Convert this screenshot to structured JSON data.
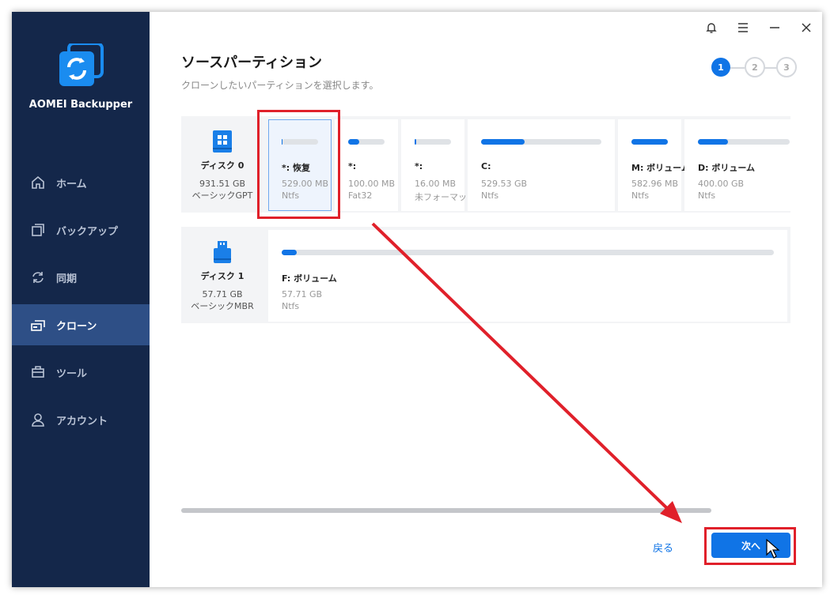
{
  "app": {
    "brand": "AOMEI Backupper"
  },
  "sidebar": {
    "items": [
      {
        "label": "ホーム",
        "icon": "home-icon"
      },
      {
        "label": "バックアップ",
        "icon": "backup-icon"
      },
      {
        "label": "同期",
        "icon": "sync-icon"
      },
      {
        "label": "クローン",
        "icon": "clone-icon",
        "active": true
      },
      {
        "label": "ツール",
        "icon": "tools-icon"
      },
      {
        "label": "アカウント",
        "icon": "account-icon"
      }
    ]
  },
  "header": {
    "title": "ソースパーティション",
    "subtitle": "クローンしたいパーティションを選択します。"
  },
  "steps": {
    "labels": [
      "1",
      "2",
      "3"
    ],
    "current": 1
  },
  "disks": [
    {
      "name": "ディスク 0",
      "size": "931.51 GB",
      "style": "ベーシックGPT",
      "partitions": [
        {
          "name": "*: 恢复",
          "size": "529.00 MB",
          "fs": "Ntfs",
          "used": 0.02,
          "selected": true
        },
        {
          "name": "*:",
          "size": "100.00 MB",
          "fs": "Fat32",
          "used": 0.3
        },
        {
          "name": "*:",
          "size": "16.00 MB",
          "fs": "未フォーマット",
          "used": 0.05
        },
        {
          "name": "C:",
          "size": "529.53 GB",
          "fs": "Ntfs",
          "used": 0.36
        },
        {
          "name": "M: ボリューム",
          "size": "582.96 MB",
          "fs": "Ntfs",
          "used": 1.0
        },
        {
          "name": "D: ボリューム",
          "size": "400.00 GB",
          "fs": "Ntfs",
          "used": 0.33
        }
      ]
    },
    {
      "name": "ディスク 1",
      "size": "57.71 GB",
      "style": "ベーシックMBR",
      "partitions": [
        {
          "name": "F: ボリューム",
          "size": "57.71 GB",
          "fs": "Ntfs",
          "used": 0.005
        }
      ]
    }
  ],
  "footer": {
    "back_label": "戻る",
    "next_label": "次へ"
  },
  "colors": {
    "accent": "#1074e6",
    "sidebar_bg": "#14274a",
    "annotation": "#e0202a"
  }
}
